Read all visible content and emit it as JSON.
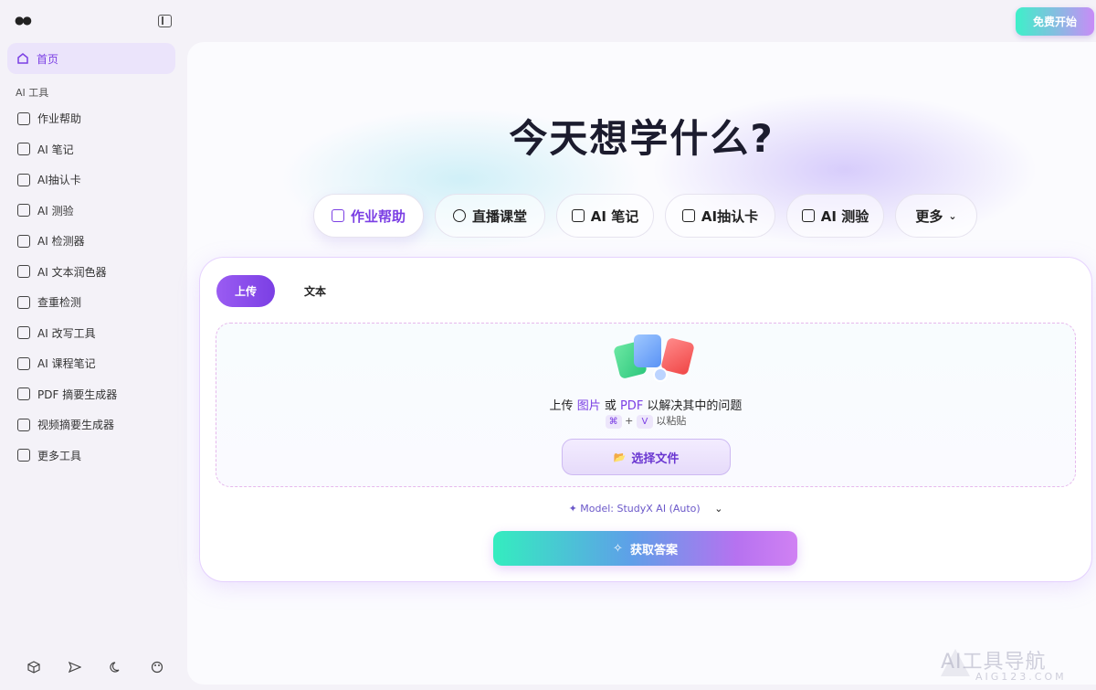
{
  "sidebar": {
    "logo": "●●",
    "home_label": "首页",
    "section_title": "AI 工具",
    "items": [
      {
        "label": "作业帮助",
        "icon": "homework-icon"
      },
      {
        "label": "AI 笔记",
        "icon": "notes-icon"
      },
      {
        "label": "AI抽认卡",
        "icon": "flashcard-icon"
      },
      {
        "label": "AI 测验",
        "icon": "quiz-icon"
      },
      {
        "label": "AI 检测器",
        "icon": "detector-icon"
      },
      {
        "label": "AI 文本润色器",
        "icon": "polish-icon"
      },
      {
        "label": "查重检测",
        "icon": "plagiarism-icon"
      },
      {
        "label": "AI 改写工具",
        "icon": "rewrite-icon"
      },
      {
        "label": "AI 课程笔记",
        "icon": "course-notes-icon"
      },
      {
        "label": "PDF 摘要生成器",
        "icon": "pdf-icon"
      },
      {
        "label": "视频摘要生成器",
        "icon": "video-icon"
      },
      {
        "label": "更多工具",
        "icon": "more-icon"
      }
    ],
    "bottom_icons": [
      "cube-icon",
      "send-icon",
      "moon-icon",
      "palette-icon"
    ]
  },
  "header": {
    "start_label": "免费开始"
  },
  "hero": {
    "title": "今天想学什么?"
  },
  "tabs": [
    {
      "label": "作业帮助",
      "active": true
    },
    {
      "label": "直播课堂",
      "active": false
    },
    {
      "label": "AI 笔记",
      "active": false
    },
    {
      "label": "AI抽认卡",
      "active": false
    },
    {
      "label": "AI 测验",
      "active": false
    },
    {
      "label": "更多",
      "active": false
    }
  ],
  "card": {
    "segment_upload": "上传",
    "segment_text": "文本",
    "drop_prefix": "上传 ",
    "drop_image": "图片",
    "drop_or": " 或 ",
    "drop_pdf": "PDF",
    "drop_suffix": " 以解决其中的问题",
    "key_cmd": "⌘",
    "key_plus": "+",
    "key_v": "V",
    "paste_label": "以粘贴",
    "choose_label": "选择文件",
    "model_label": "Model: StudyX AI (Auto)",
    "answer_label": "获取答案"
  },
  "watermark": {
    "text": "AI工具导航",
    "sub": "AIG123.COM"
  },
  "colors": {
    "accent": "#7b3fe4",
    "teal": "#34edbf"
  }
}
